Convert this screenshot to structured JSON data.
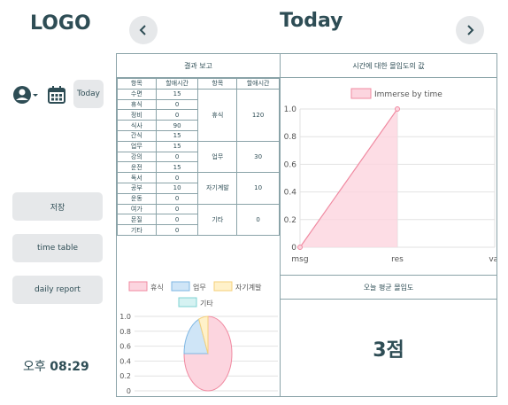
{
  "header": {
    "logo": "LOGO",
    "title": "Today",
    "prev_label": "previous",
    "next_label": "next"
  },
  "sidebar": {
    "today_label": "Today",
    "buttons": [
      "저장",
      "time table",
      "daily report"
    ],
    "clock": {
      "ampm": "오후",
      "time": "08:29"
    }
  },
  "report": {
    "title": "결과 보고",
    "headers": [
      "항목",
      "할애시간",
      "항목",
      "할애시간"
    ],
    "rows": [
      {
        "item": "수면",
        "time": "15"
      },
      {
        "item": "휴식",
        "time": "0"
      },
      {
        "item": "정비",
        "time": "0"
      },
      {
        "item": "식사",
        "time": "90"
      },
      {
        "item": "간식",
        "time": "15"
      },
      {
        "item": "업무",
        "time": "15"
      },
      {
        "item": "강의",
        "time": "0"
      },
      {
        "item": "운전",
        "time": "15"
      },
      {
        "item": "독서",
        "time": "0"
      },
      {
        "item": "공부",
        "time": "10"
      },
      {
        "item": "운동",
        "time": "0"
      },
      {
        "item": "여가",
        "time": "0"
      },
      {
        "item": "몬질",
        "time": "0"
      },
      {
        "item": "기타",
        "time": "0"
      }
    ],
    "groups": [
      {
        "name": "휴식",
        "time": "120"
      },
      {
        "name": "업무",
        "time": "30"
      },
      {
        "name": "자기계발",
        "time": "10"
      },
      {
        "name": "기타",
        "time": "0"
      }
    ]
  },
  "immersion": {
    "title": "시간에 대한 몰입도의 값"
  },
  "average": {
    "title": "오늘 평균 몰입도",
    "score": "3점"
  },
  "chart_data": [
    {
      "type": "area",
      "series": [
        {
          "name": "Immerse by time",
          "values": [
            0,
            1.0
          ]
        }
      ],
      "categories": [
        "msg",
        "res",
        "val"
      ],
      "ylim": [
        0,
        1.0
      ],
      "yticks": [
        "0",
        "0.2",
        "0.4",
        "0.6",
        "0.8",
        "1.0"
      ],
      "grid": true,
      "legend": "top",
      "colors": {
        "fill": "#fcd5df",
        "stroke": "#f08aa1"
      }
    },
    {
      "type": "pie",
      "labels": [
        "휴식",
        "업무",
        "자기계발",
        "기타"
      ],
      "values": [
        120,
        30,
        10,
        0
      ],
      "colors": [
        "#fcd5df",
        "#cfe5f7",
        "#fff1c9",
        "#d5f2f2"
      ],
      "strokes": [
        "#f08aa1",
        "#7fb7e3",
        "#f5d07a",
        "#7fd3d3"
      ],
      "yticks": [
        "0",
        "0.2",
        "0.4",
        "0.6",
        "0.8",
        "1.0"
      ],
      "grid": true,
      "legend": "top"
    }
  ]
}
